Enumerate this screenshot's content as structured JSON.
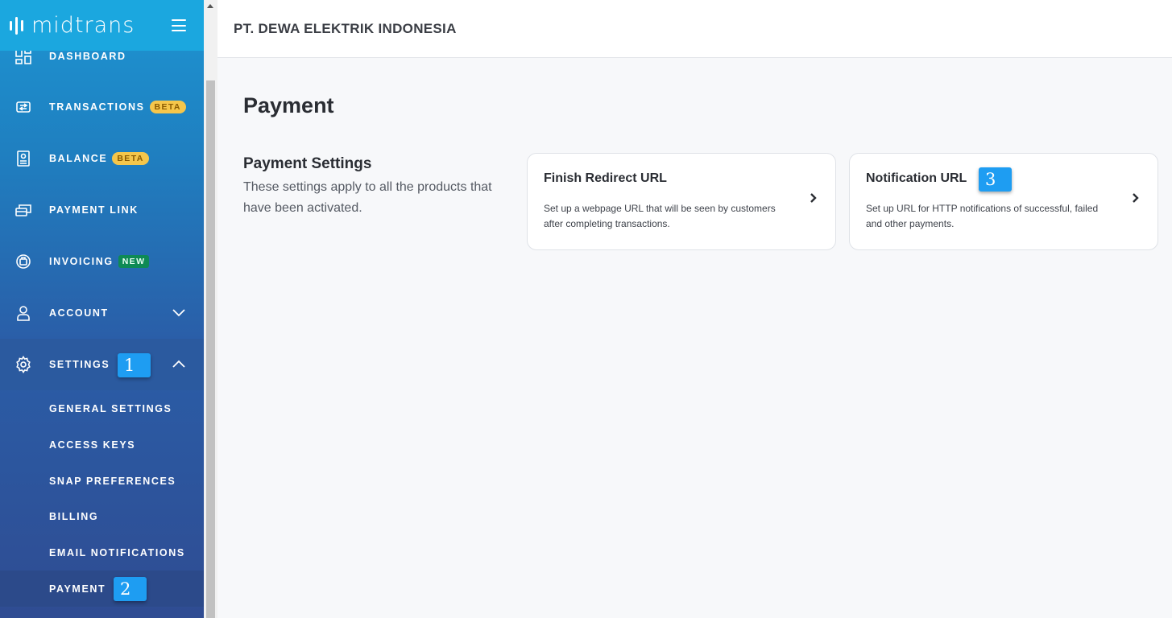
{
  "brand": {
    "name": "midtrans"
  },
  "merchant": {
    "name": "PT. DEWA ELEKTRIK INDONESIA"
  },
  "sidebar": {
    "items": [
      {
        "label": "DASHBOARD",
        "icon": "dashboard-icon"
      },
      {
        "label": "TRANSACTIONS",
        "icon": "transactions-icon",
        "badge": "BETA"
      },
      {
        "label": "BALANCE",
        "icon": "balance-icon",
        "badge": "BETA"
      },
      {
        "label": "PAYMENT LINK",
        "icon": "payment-link-icon"
      },
      {
        "label": "INVOICING",
        "icon": "invoicing-icon",
        "badge": "NEW"
      },
      {
        "label": "ACCOUNT",
        "icon": "account-icon",
        "expand": "chevron-down-icon"
      },
      {
        "label": "SETTINGS",
        "icon": "gear-icon",
        "expand": "chevron-up-icon"
      }
    ],
    "settings_sub": [
      {
        "label": "GENERAL SETTINGS"
      },
      {
        "label": "ACCESS KEYS"
      },
      {
        "label": "SNAP PREFERENCES"
      },
      {
        "label": "BILLING"
      },
      {
        "label": "EMAIL NOTIFICATIONS"
      },
      {
        "label": "PAYMENT"
      }
    ]
  },
  "markers": {
    "m1": "1",
    "m2": "2",
    "m3": "3"
  },
  "main": {
    "title": "Payment",
    "section": {
      "title": "Payment Settings",
      "description": "These settings apply to all the products that have been activated."
    },
    "cards": [
      {
        "title": "Finish Redirect URL",
        "description": "Set up a webpage URL that will be seen by customers after completing transactions."
      },
      {
        "title": "Notification URL",
        "description": "Set up URL for HTTP notifications of successful, failed and other payments."
      }
    ]
  },
  "colors": {
    "sidebar_top": "#1ba7df",
    "sidebar_bottom": "#2f4c92",
    "beta_badge": "#f5c64b",
    "new_badge": "#0e8a55",
    "marker": "#1e9df2"
  }
}
